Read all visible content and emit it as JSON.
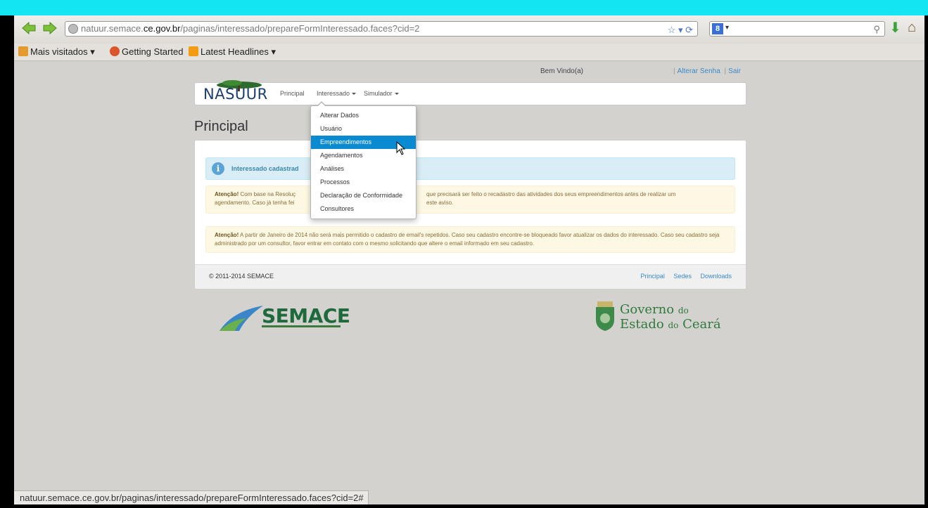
{
  "browser": {
    "url_prefix": "natuur.semace.",
    "url_host": "ce.gov.br",
    "url_path": "/paginas/interessado/prepareFormInteressado.faces?cid=2",
    "bookmarks": [
      {
        "label": "Mais visitados ▾"
      },
      {
        "label": "Getting Started"
      },
      {
        "label": "Latest Headlines ▾"
      }
    ],
    "status_url": "natuur.semace.ce.gov.br/paginas/interessado/prepareFormInteressado.faces?cid=2#"
  },
  "header": {
    "welcome": "Bem Vindo(a)",
    "links": [
      "Alterar Senha",
      "Sair"
    ]
  },
  "nav": {
    "brand": "NASUUR",
    "items": [
      "Principal",
      "Interessado",
      "Simulador"
    ]
  },
  "dropdown": {
    "items": [
      "Alterar Dados",
      "Usuário",
      "Empreendimentos",
      "Agendamentos",
      "Análises",
      "Processos",
      "Declaração de Conformidade",
      "Consultores"
    ],
    "active_index": 2
  },
  "main": {
    "title": "Principal",
    "info": "Interessado cadastrad",
    "warning1_label": "Atenção!",
    "warning1_line1a": "Com base na Resoluç",
    "warning1_line1b": "que precisará ser feito o recadastro das atividades dos seus empreendimentos antes de realizar um",
    "warning1_line2a": "agendamento. Caso já tenha fei",
    "warning1_line2b": "este aviso.",
    "warning2_label": "Atenção!",
    "warning2_text": "A partir de Janeiro de 2014 não será mais permitido o cadastro de email's repetidos. Caso seu cadastro encontre-se bloqueado favor atualizar os dados do interessado. Caso seu cadastro seja administrado por um consultor, favor entrar em contato com o mesmo solicitando que altere o email informado em seu cadastro."
  },
  "footer": {
    "copyright": "© 2011-2014 SEMACE",
    "links": [
      "Principal",
      "Sedes",
      "Downloads"
    ]
  },
  "logos": {
    "semace": "SEMACE",
    "governo_line1a": "Governo",
    "governo_line1b": "do",
    "governo_line2a": "Estado",
    "governo_line2b": "do",
    "governo_line2c": "Ceará"
  }
}
